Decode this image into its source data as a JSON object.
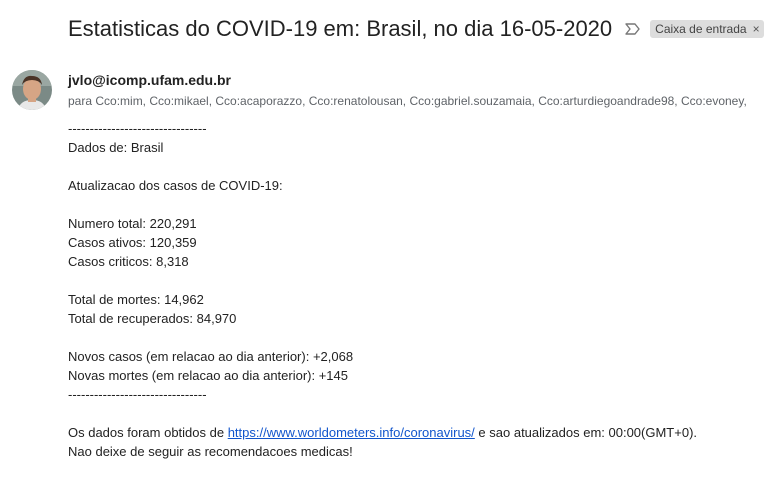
{
  "email": {
    "subject": "Estatisticas do COVID-19 em: Brasil, no dia 16-05-2020",
    "label": "Caixa de entrada",
    "label_close": "×",
    "sender": "jvlo@icomp.ufam.edu.br",
    "recipients": "para Cco:mim, Cco:mikael, Cco:acaporazzo, Cco:renatolousan, Cco:gabriel.souzamaia, Cco:arturdiegoandrade98, Cco:evoney,"
  },
  "body": {
    "separator_top": "--------------------------------",
    "dados": "Dados de: Brasil",
    "atualizacao": "Atualizacao dos casos de COVID-19:",
    "numero_total": "Numero total: 220,291",
    "casos_ativos": "Casos ativos: 120,359",
    "casos_criticos": "Casos criticos: 8,318",
    "total_mortes": "Total de mortes: 14,962",
    "total_recuperados": "Total de recuperados: 84,970",
    "novos_casos": "Novos casos (em relacao ao dia anterior): +2,068",
    "novas_mortes": "Novas mortes (em relacao ao dia anterior): +145",
    "separator_bottom": "--------------------------------",
    "source_prefix": "Os dados foram obtidos de ",
    "source_link": "https://www.worldometers.info/coronavirus/",
    "source_suffix": " e sao atualizados em: 00:00(GMT+0).",
    "closing": "Nao deixe de seguir as recomendacoes medicas!"
  },
  "colors": {
    "link": "#1155cc",
    "chip_bg": "#dddddd",
    "meta_text": "#5f6368"
  },
  "icons": [
    "important-marker-icon",
    "close-icon",
    "avatar"
  ]
}
